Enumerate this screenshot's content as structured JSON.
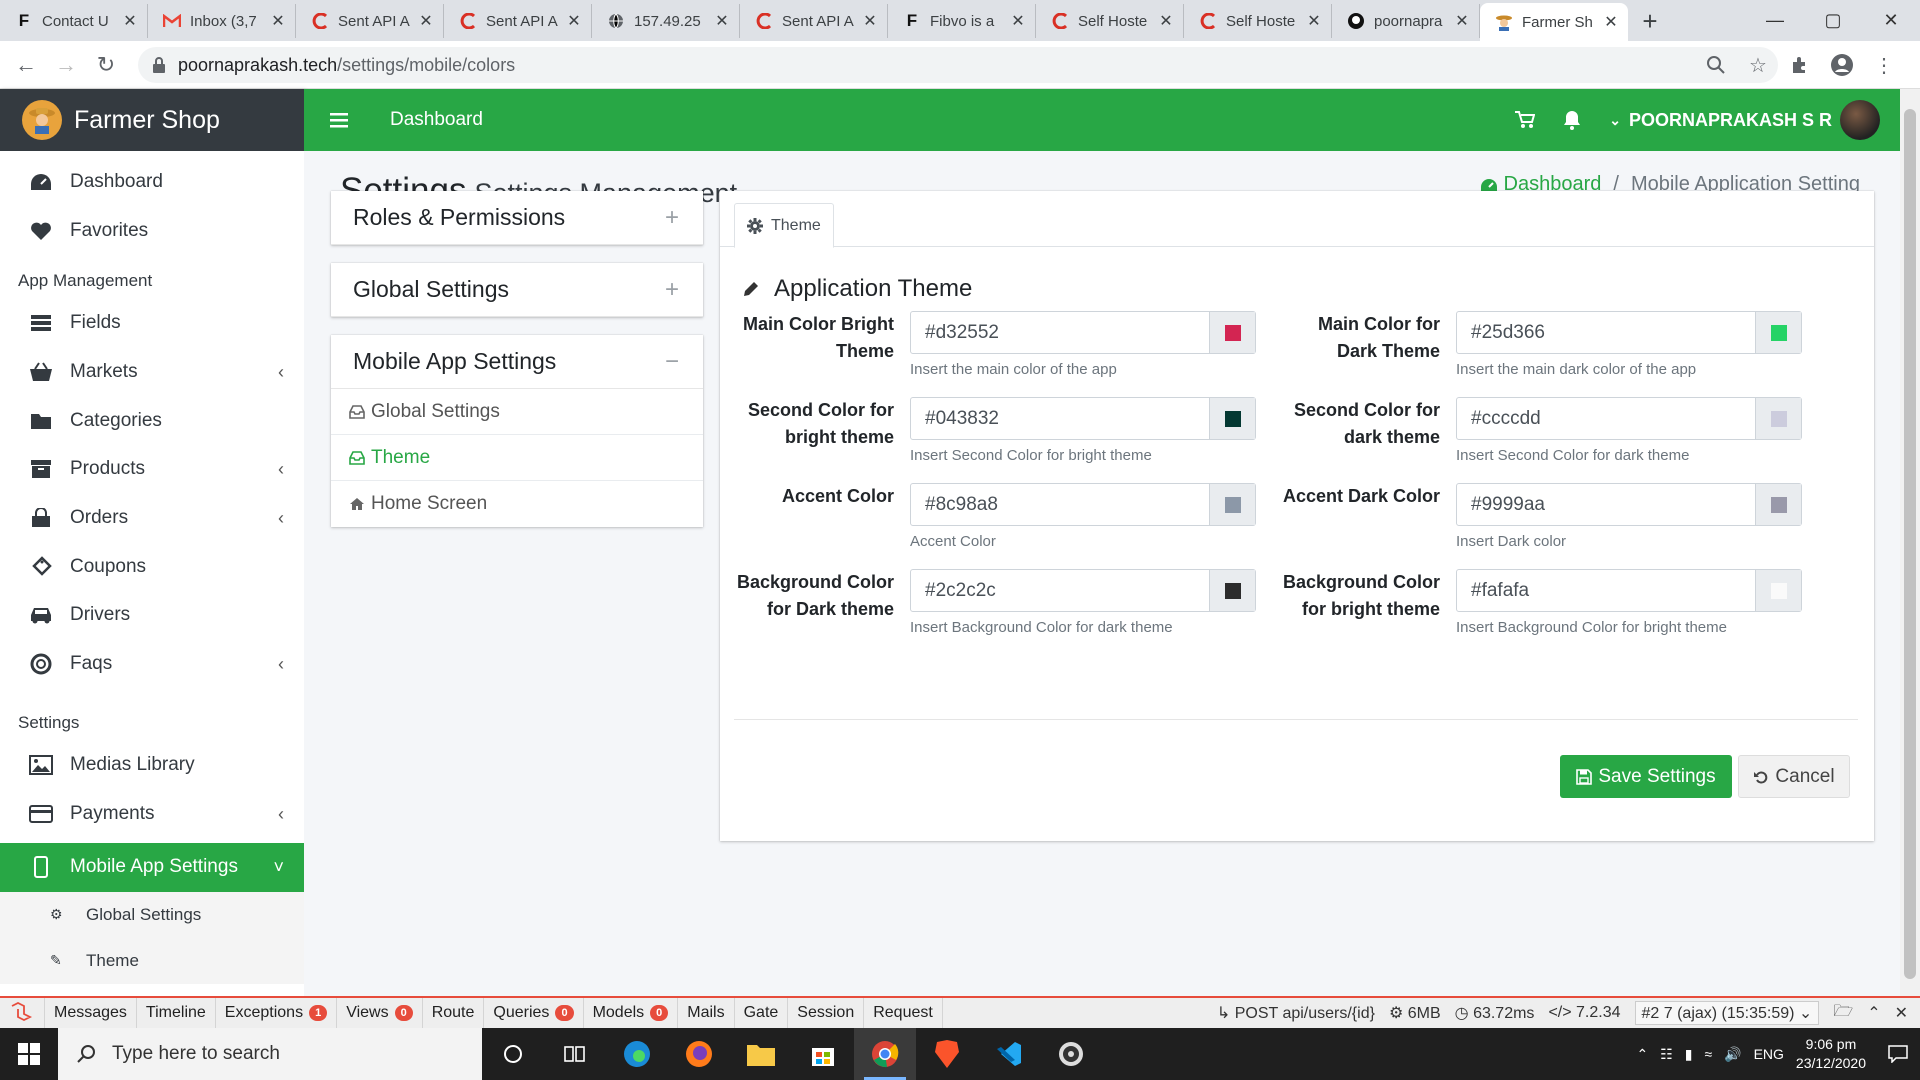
{
  "browser": {
    "tabs": [
      {
        "title": "Contact U",
        "icon": "F"
      },
      {
        "title": "Inbox (3,7",
        "icon": "M"
      },
      {
        "title": "Sent API A",
        "icon": "C"
      },
      {
        "title": "Sent API A",
        "icon": "C"
      },
      {
        "title": "157.49.25",
        "icon": "globe"
      },
      {
        "title": "Sent API A",
        "icon": "C"
      },
      {
        "title": "Fibvo is a",
        "icon": "F"
      },
      {
        "title": "Self Hoste",
        "icon": "C"
      },
      {
        "title": "Self Hoste",
        "icon": "C"
      },
      {
        "title": "poornapra",
        "icon": "github"
      },
      {
        "title": "Farmer Sh",
        "icon": "farmer",
        "active": true
      }
    ],
    "url_host": "poornaprakash.tech",
    "url_path": "/settings/mobile/colors"
  },
  "app": {
    "brand": "Farmer Shop",
    "nav_title": "Dashboard",
    "user_name": "POORNAPRAKASH S R",
    "accent_color": "#28a745"
  },
  "sidebar": {
    "items_top": [
      {
        "label": "Dashboard",
        "icon": "tachometer-icon"
      },
      {
        "label": "Favorites",
        "icon": "heart-icon"
      }
    ],
    "app_management_heading": "App Management",
    "app_items": [
      {
        "label": "Fields",
        "icon": "list-icon",
        "chevron": false
      },
      {
        "label": "Markets",
        "icon": "basket-icon",
        "chevron": true
      },
      {
        "label": "Categories",
        "icon": "folder-icon",
        "chevron": false
      },
      {
        "label": "Products",
        "icon": "archive-icon",
        "chevron": true
      },
      {
        "label": "Orders",
        "icon": "shopping-bag-icon",
        "chevron": true
      },
      {
        "label": "Coupons",
        "icon": "ticket-icon",
        "chevron": false
      },
      {
        "label": "Drivers",
        "icon": "car-icon",
        "chevron": false
      },
      {
        "label": "Faqs",
        "icon": "lifebuoy-icon",
        "chevron": true
      }
    ],
    "settings_heading": "Settings",
    "settings_items": [
      {
        "label": "Medias Library",
        "icon": "image-icon",
        "chevron": false
      },
      {
        "label": "Payments",
        "icon": "credit-card-icon",
        "chevron": true
      }
    ],
    "active_item": "Mobile App Settings",
    "sub_items": [
      "Global Settings",
      "Theme"
    ]
  },
  "page": {
    "title": "Settings",
    "subtitle": "Settings Management",
    "breadcrumb_home": "Dashboard",
    "breadcrumb_current": "Mobile Application Setting"
  },
  "accordion": {
    "roles": "Roles & Permissions",
    "global": "Global Settings",
    "mobile": "Mobile App Settings",
    "mobile_items": [
      "Global Settings",
      "Theme",
      "Home Screen"
    ]
  },
  "theme_panel": {
    "tab_label": "Theme",
    "section_title": "Application Theme",
    "fields": [
      {
        "label": "Main Color Bright Theme",
        "value": "#d32552",
        "help": "Insert the main color of the app"
      },
      {
        "label": "Main Color for Dark Theme",
        "value": "#25d366",
        "help": "Insert the main dark color of the app"
      },
      {
        "label": "Second Color for bright theme",
        "value": "#043832",
        "help": "Insert Second Color for bright theme"
      },
      {
        "label": "Second Color for dark theme",
        "value": "#ccccdd",
        "help": "Insert Second Color for dark theme"
      },
      {
        "label": "Accent Color",
        "value": "#8c98a8",
        "help": "Accent Color"
      },
      {
        "label": "Accent Dark Color",
        "value": "#9999aa",
        "help": "Insert Dark color"
      },
      {
        "label": "Background Color for Dark theme",
        "value": "#2c2c2c",
        "help": "Insert Background Color for dark theme"
      },
      {
        "label": "Background Color for bright theme",
        "value": "#fafafa",
        "help": "Insert Background Color for bright theme"
      }
    ],
    "save_label": "Save Settings",
    "cancel_label": "Cancel"
  },
  "debugbar": {
    "items": [
      {
        "label": "Messages"
      },
      {
        "label": "Timeline"
      },
      {
        "label": "Exceptions",
        "badge": "1"
      },
      {
        "label": "Views",
        "badge": "0"
      },
      {
        "label": "Route"
      },
      {
        "label": "Queries",
        "badge": "0"
      },
      {
        "label": "Models",
        "badge": "0"
      },
      {
        "label": "Mails"
      },
      {
        "label": "Gate"
      },
      {
        "label": "Session"
      },
      {
        "label": "Request"
      }
    ],
    "route": "POST api/users/{id}",
    "memory": "6MB",
    "time": "63.72ms",
    "php": "7.2.34",
    "request": "#2 7 (ajax) (15:35:59)"
  },
  "taskbar": {
    "search_placeholder": "Type here to search",
    "lang": "ENG",
    "time": "9:06 pm",
    "date": "23/12/2020"
  }
}
